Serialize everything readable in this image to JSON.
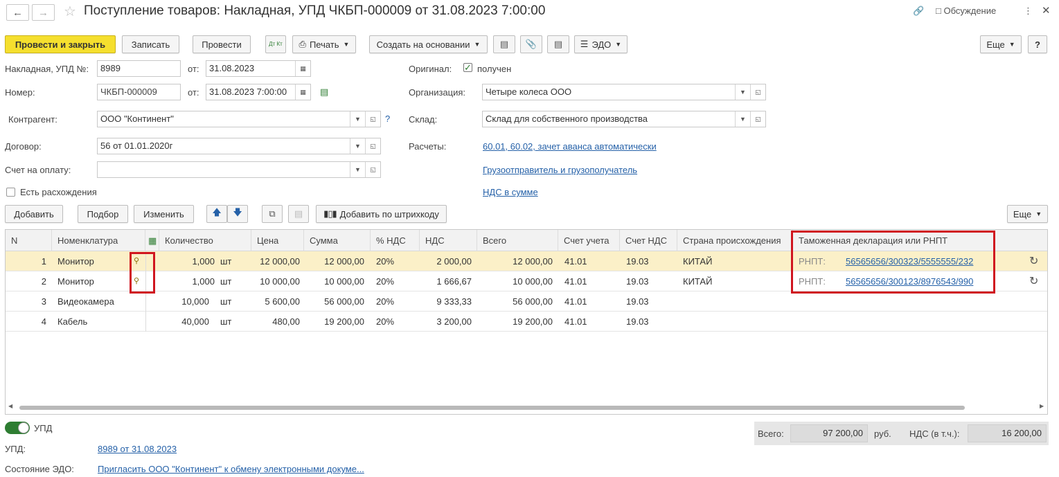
{
  "window": {
    "title": "Поступление товаров: Накладная, УПД ЧКБП-000009 от 31.08.2023 7:00:00",
    "discussion": "Обсуждение"
  },
  "toolbar": {
    "post_close": "Провести и закрыть",
    "save": "Записать",
    "post": "Провести",
    "dtkt": "Дт Кт",
    "print": "Печать",
    "create_based": "Создать на основании",
    "edo": "ЭДО",
    "more": "Еще",
    "help": "?"
  },
  "header": {
    "invoice_label": "Накладная, УПД №:",
    "invoice_no": "8989",
    "from_label": "от:",
    "invoice_date": "31.08.2023",
    "number_label": "Номер:",
    "number": "ЧКБП-000009",
    "number_from_label": "от:",
    "number_date": "31.08.2023  7:00:00",
    "counterparty_label": "Контрагент:",
    "counterparty": "ООО \"Континент\"",
    "contract_label": "Договор:",
    "contract": "56 от 01.01.2020г",
    "payment_label": "Счет на оплату:",
    "payment": "",
    "discrepancy_label": "Есть расхождения",
    "original_label": "Оригинал:",
    "original_value": "получен",
    "org_label": "Организация:",
    "org": "Четыре колеса ООО",
    "warehouse_label": "Склад:",
    "warehouse": "Склад для собственного производства",
    "settlements_label": "Расчеты:",
    "settlements": "60.01, 60.02, зачет аванса автоматически",
    "shipper_link": "Грузоотправитель и грузополучатель",
    "vat_link": "НДС в сумме"
  },
  "table_toolbar": {
    "add": "Добавить",
    "pick": "Подбор",
    "edit": "Изменить",
    "barcode": "Добавить по штрихкоду",
    "more": "Еще"
  },
  "columns": [
    "N",
    "Номенклатура",
    "Количество",
    "Цена",
    "Сумма",
    "% НДС",
    "НДС",
    "Всего",
    "Счет учета",
    "Счет НДС",
    "Страна происхождения",
    "Таможенная декларация или РНПТ"
  ],
  "rows": [
    {
      "n": "1",
      "item": "Монитор",
      "qty": "1,000",
      "unit": "шт",
      "price": "12 000,00",
      "sum": "12 000,00",
      "vat_rate": "20%",
      "vat": "2 000,00",
      "total": "12 000,00",
      "acc": "41.01",
      "vat_acc": "19.03",
      "country": "КИТАЙ",
      "decl_prefix": "РНПТ:",
      "decl": "56565656/300323/5555555/232"
    },
    {
      "n": "2",
      "item": "Монитор",
      "qty": "1,000",
      "unit": "шт",
      "price": "10 000,00",
      "sum": "10 000,00",
      "vat_rate": "20%",
      "vat": "1 666,67",
      "total": "10 000,00",
      "acc": "41.01",
      "vat_acc": "19.03",
      "country": "КИТАЙ",
      "decl_prefix": "РНПТ:",
      "decl": "56565656/300123/8976543/990"
    },
    {
      "n": "3",
      "item": "Видеокамера",
      "qty": "10,000",
      "unit": "шт",
      "price": "5 600,00",
      "sum": "56 000,00",
      "vat_rate": "20%",
      "vat": "9 333,33",
      "total": "56 000,00",
      "acc": "41.01",
      "vat_acc": "19.03",
      "country": "",
      "decl_prefix": "",
      "decl": ""
    },
    {
      "n": "4",
      "item": "Кабель",
      "qty": "40,000",
      "unit": "шт",
      "price": "480,00",
      "sum": "19 200,00",
      "vat_rate": "20%",
      "vat": "3 200,00",
      "total": "19 200,00",
      "acc": "41.01",
      "vat_acc": "19.03",
      "country": "",
      "decl_prefix": "",
      "decl": ""
    }
  ],
  "footer": {
    "upd_toggle_label": "УПД",
    "upd_label": "УПД:",
    "upd_link": "8989 от 31.08.2023",
    "edo_label": "Состояние ЭДО:",
    "edo_link": "Пригласить ООО \"Континент\" к обмену электронными докуме...",
    "total_label": "Всего:",
    "total": "97 200,00",
    "currency": "руб.",
    "vat_label": "НДС (в т.ч.):",
    "vat": "16 200,00"
  },
  "colors": {
    "primary": "#f5df2e",
    "highlight": "#d0151f",
    "link": "#2561a8",
    "selected_row": "#fbf0c8"
  }
}
